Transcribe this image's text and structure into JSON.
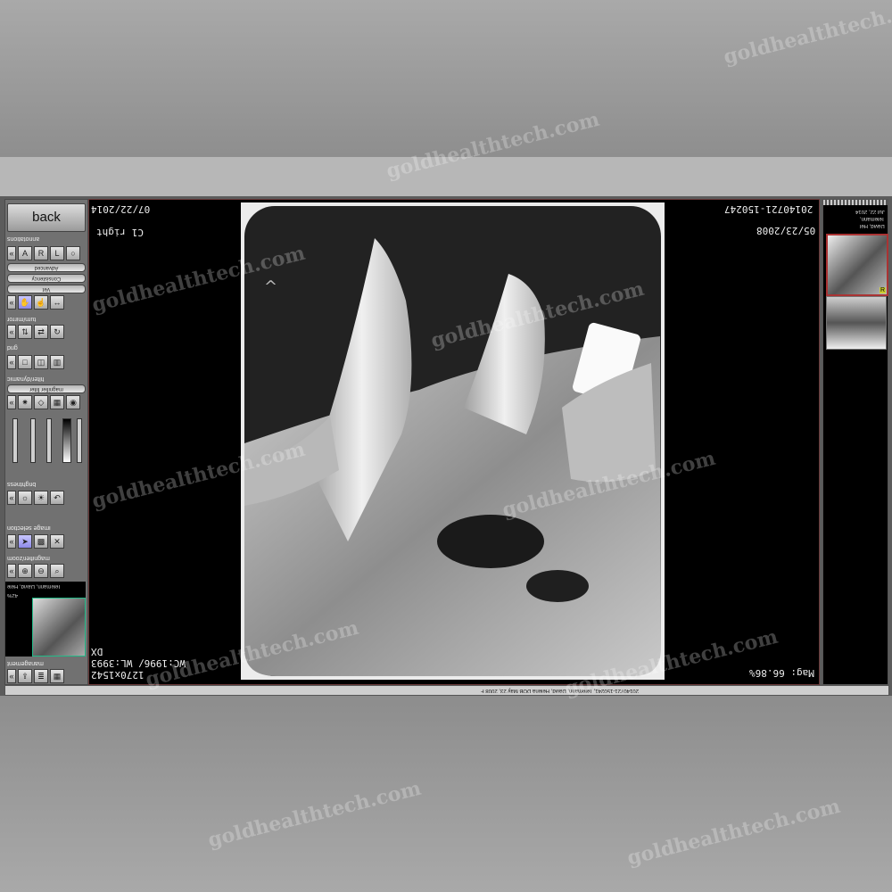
{
  "watermark": "goldhealthtech.com",
  "left_panel": {
    "back_label": "back",
    "sections": {
      "annotations": "annotations",
      "turn_mirror": "turn/mirror",
      "grid": "grid",
      "filter_dynamic": "filter/dynamic",
      "brightness": "brightness",
      "image_selection": "image selection",
      "magnifier_zoom": "magnifier/zoom",
      "management": "management"
    },
    "pills": {
      "advanced": "Advanced",
      "consistency": "Consistency",
      "vet": "Vet",
      "magnifier_filter": "magnifier filter"
    },
    "tool_r": "R",
    "tool_l": "L",
    "thumb_patient": "Telemann, David, Hele",
    "thumb_zoom": "42%"
  },
  "viewer": {
    "date_top_left": "07/22/2014",
    "tooth_label": "C1 right",
    "study_id": "20140721-150247",
    "birth_date": "05/23/2008",
    "modality": "DX",
    "window": "WC:1996/ WL:3993",
    "dimensions": "1270x1542",
    "magnification": "Mag: 66.86%",
    "marker": "^"
  },
  "right_panel": {
    "date": "Jul 22, 2014",
    "patient_line1": "Telemann,",
    "patient_line2": "David, Hel",
    "thumb_badge": "R"
  },
  "status_bar": {
    "text": "20140721-150241, Telemann, David, Helena DOB May 23, 2008 F"
  }
}
